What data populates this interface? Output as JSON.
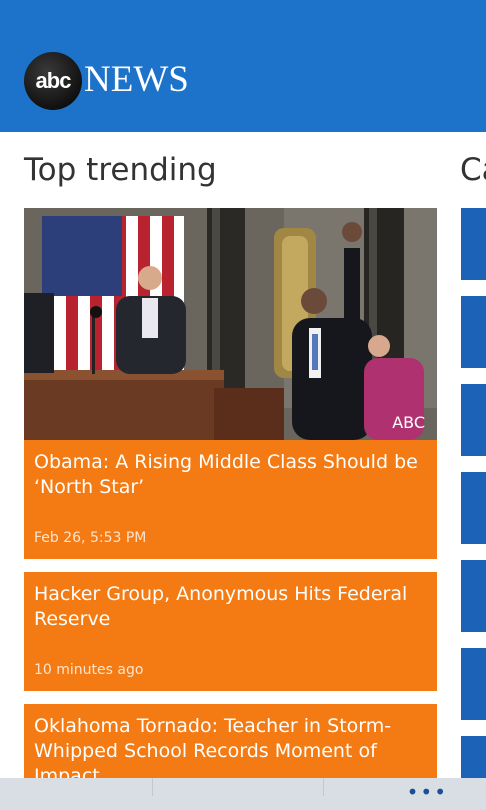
{
  "header": {
    "logo_abc": "abc",
    "logo_news": "NEWS"
  },
  "sections": {
    "top_trending_title": "Top trending",
    "categories_title_partial": "Ca"
  },
  "hero": {
    "credit": "ABC"
  },
  "stories": [
    {
      "title": "Obama: A Rising Middle Class Should be ‘North Star’",
      "time": "Feb 26, 5:53 PM"
    },
    {
      "title": "Hacker Group, Anonymous Hits Federal Reserve",
      "time": "10 minutes ago"
    },
    {
      "title": "Oklahoma Tornado: Teacher in Storm-Whipped School Records Moment of Impact",
      "time": ""
    }
  ],
  "appbar": {
    "more_label": "•••"
  },
  "colors": {
    "header_blue": "#1c73c9",
    "card_orange": "#f47b13",
    "tile_blue": "#1c62b6",
    "appbar_gray": "#d9dde4"
  }
}
